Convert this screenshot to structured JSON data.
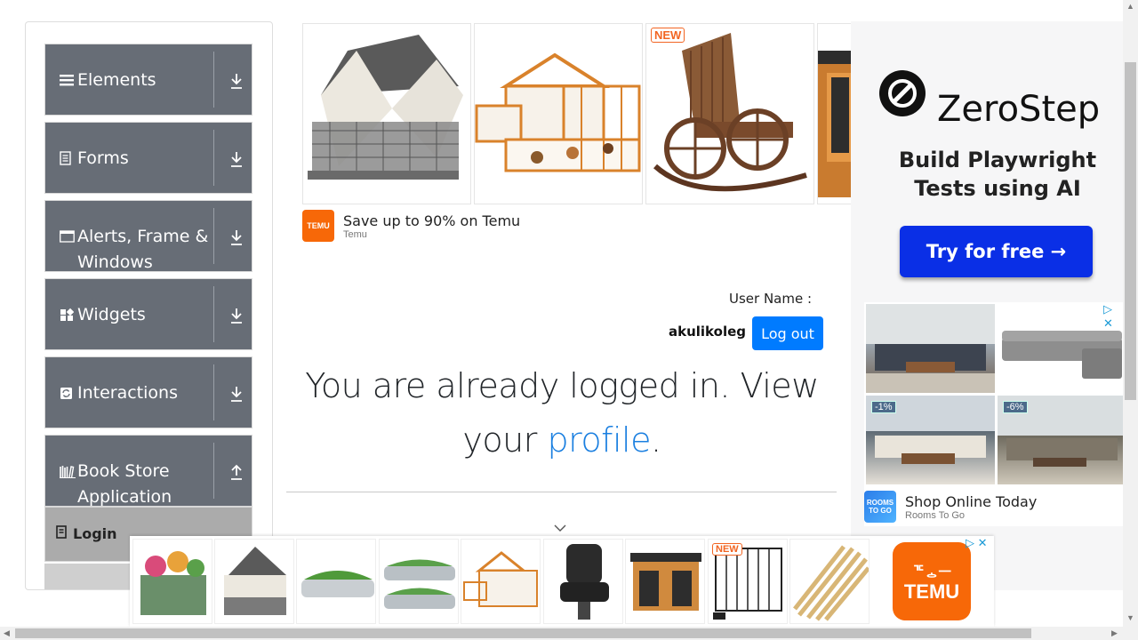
{
  "sidebar": {
    "groups": [
      {
        "label": "Elements",
        "icon": "menu-icon"
      },
      {
        "label": "Forms",
        "icon": "form-icon"
      },
      {
        "label": "Alerts, Frame & Windows",
        "icon": "window-icon"
      },
      {
        "label": "Widgets",
        "icon": "widgets-icon"
      },
      {
        "label": "Interactions",
        "icon": "interactions-icon"
      },
      {
        "label": "Book Store Application",
        "icon": "books-icon"
      }
    ],
    "active_item": {
      "label": "Login",
      "icon": "login-icon"
    }
  },
  "top_ad": {
    "new_badge": "NEW",
    "title": "Save up to 90% on Temu",
    "source": "Temu",
    "logo_text": "TEMU"
  },
  "profile": {
    "username_label": "User Name :",
    "username_value": "akulikoleg",
    "logout_label": "Log out"
  },
  "message": {
    "part1": "You are already logged in. View your",
    "link": "profile",
    "end": "."
  },
  "right_ad": {
    "brand": "ZeroStep",
    "subtitle": "Build Playwright Tests using AI",
    "cta": "Try for free →",
    "badge_1": "-1%",
    "badge_2": "-6%",
    "shop_title": "Shop Online Today",
    "shop_source": "Rooms To Go",
    "rtg_logo": "ROOMS TO GO"
  },
  "bottom_ad": {
    "new_badge": "NEW",
    "logo_glyphs": "ᅚᇰᅳ",
    "logo_word": "TEMU"
  },
  "colors": {
    "sidebar_group_bg": "#676d76",
    "logout_bg": "#007bff",
    "link": "#1a7fe0",
    "zerostep_cta": "#0a2fe6",
    "temu_orange": "#f76808"
  }
}
